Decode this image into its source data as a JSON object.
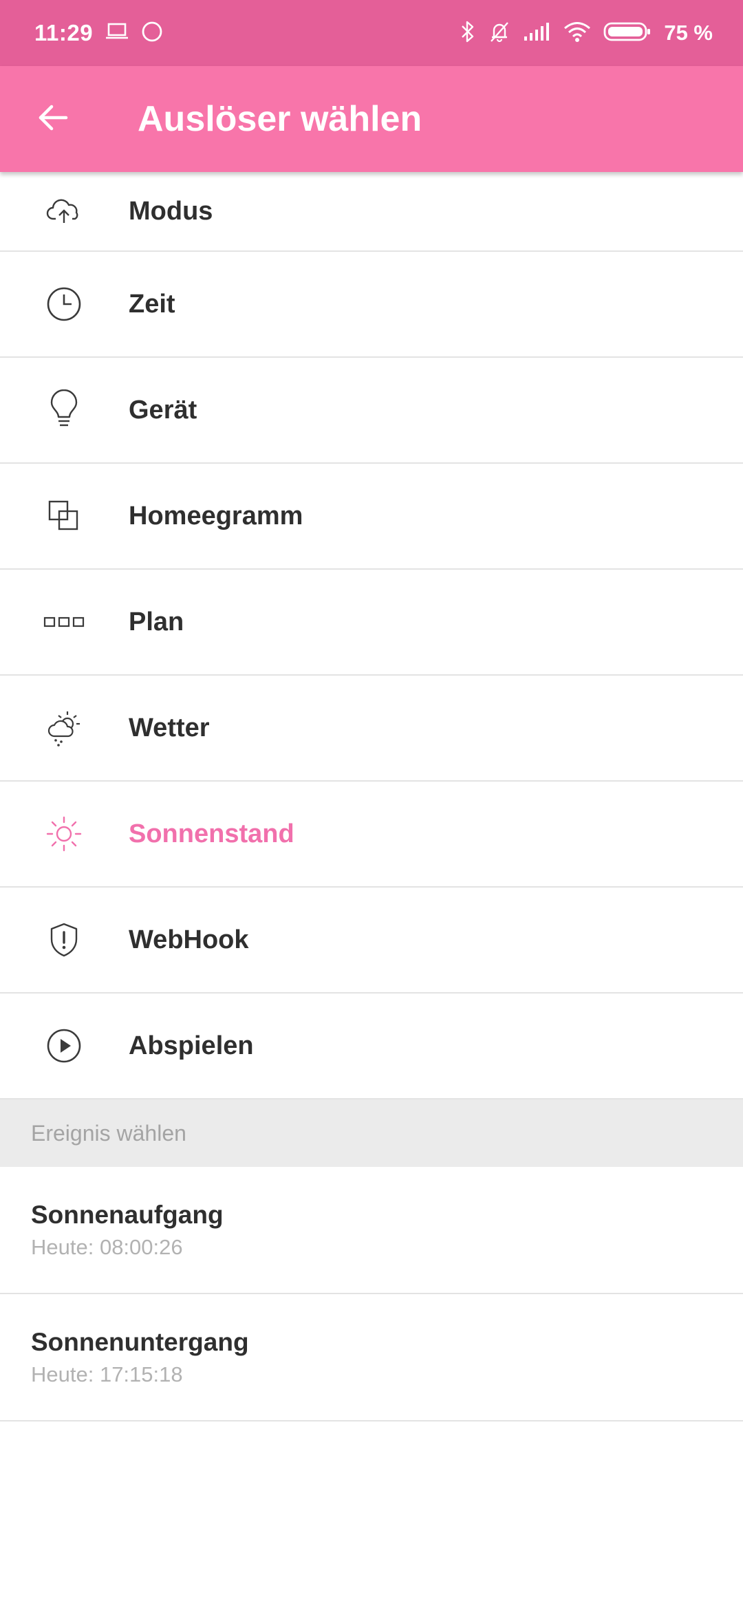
{
  "status_bar": {
    "time": "11:29",
    "battery_text": "75 %",
    "battery_level": 0.75
  },
  "app_bar": {
    "title": "Auslöser wählen",
    "background_color": "#F875AA"
  },
  "accent_color": "#F170AC",
  "triggers": [
    {
      "label": "Modus",
      "icon": "cloud-upload-icon"
    },
    {
      "label": "Zeit",
      "icon": "clock-icon"
    },
    {
      "label": "Gerät",
      "icon": "lightbulb-icon"
    },
    {
      "label": "Homeegramm",
      "icon": "homeegram-icon"
    },
    {
      "label": "Plan",
      "icon": "plan-icon"
    },
    {
      "label": "Wetter",
      "icon": "weather-icon"
    },
    {
      "label": "Sonnenstand",
      "icon": "sun-icon",
      "selected": true
    },
    {
      "label": "WebHook",
      "icon": "webhook-icon"
    },
    {
      "label": "Abspielen",
      "icon": "play-icon"
    }
  ],
  "event_section": {
    "header": "Ereignis wählen",
    "events": [
      {
        "title": "Sonnenaufgang",
        "subtitle": "Heute: 08:00:26"
      },
      {
        "title": "Sonnenuntergang",
        "subtitle": "Heute: 17:15:18"
      }
    ]
  }
}
